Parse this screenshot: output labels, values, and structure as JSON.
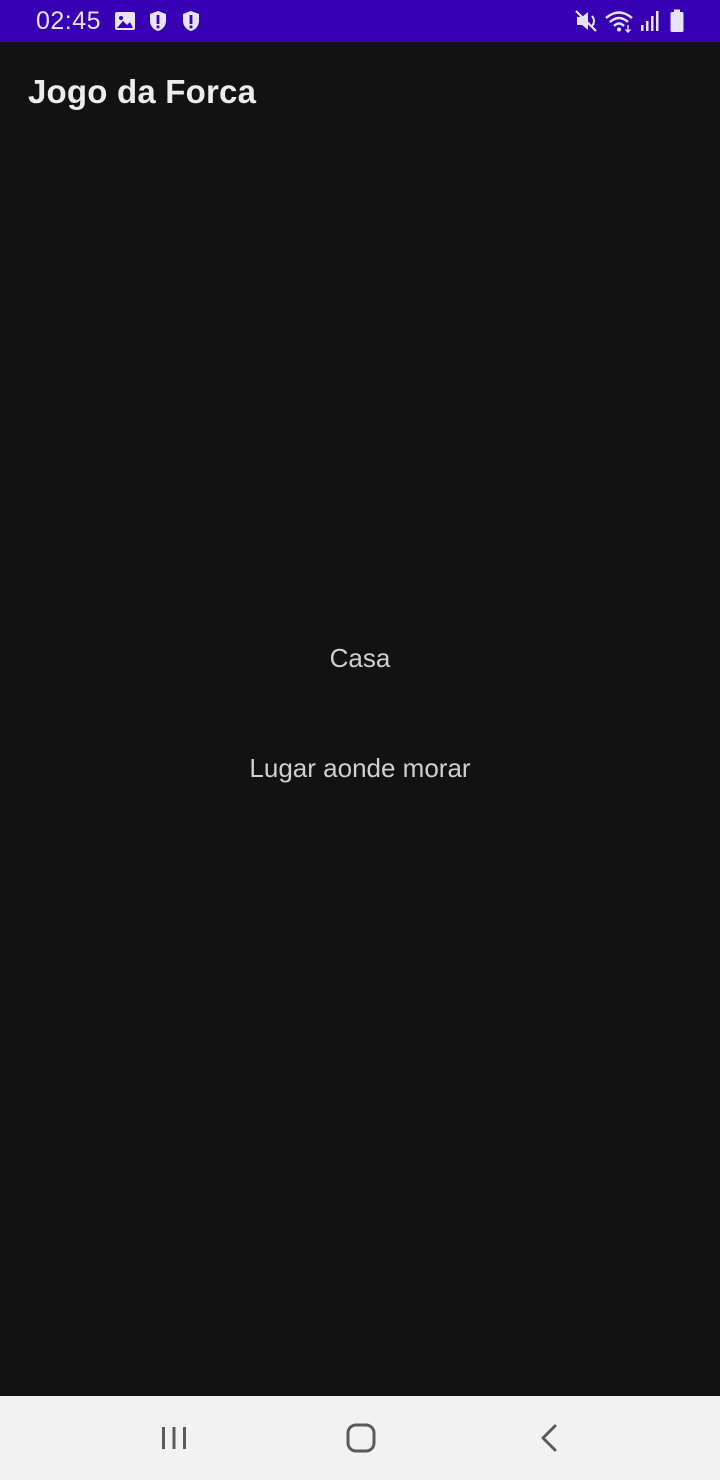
{
  "status_bar": {
    "time": "02:45",
    "background_color": "#3700b3",
    "left_icons": [
      "image-icon",
      "shield-alert-icon",
      "shield-alert-icon"
    ],
    "right_icons": [
      "mute-icon",
      "wifi-icon",
      "signal-icon",
      "battery-icon"
    ]
  },
  "app_bar": {
    "title": "Jogo da Forca"
  },
  "game": {
    "word": "Casa",
    "hint": "Lugar aonde morar"
  },
  "nav_bar": {
    "buttons": [
      "recent-apps-icon",
      "home-icon",
      "back-icon"
    ]
  },
  "colors": {
    "background": "#121212",
    "text": "#cfcfcf",
    "nav_background": "#f2f2f2"
  }
}
